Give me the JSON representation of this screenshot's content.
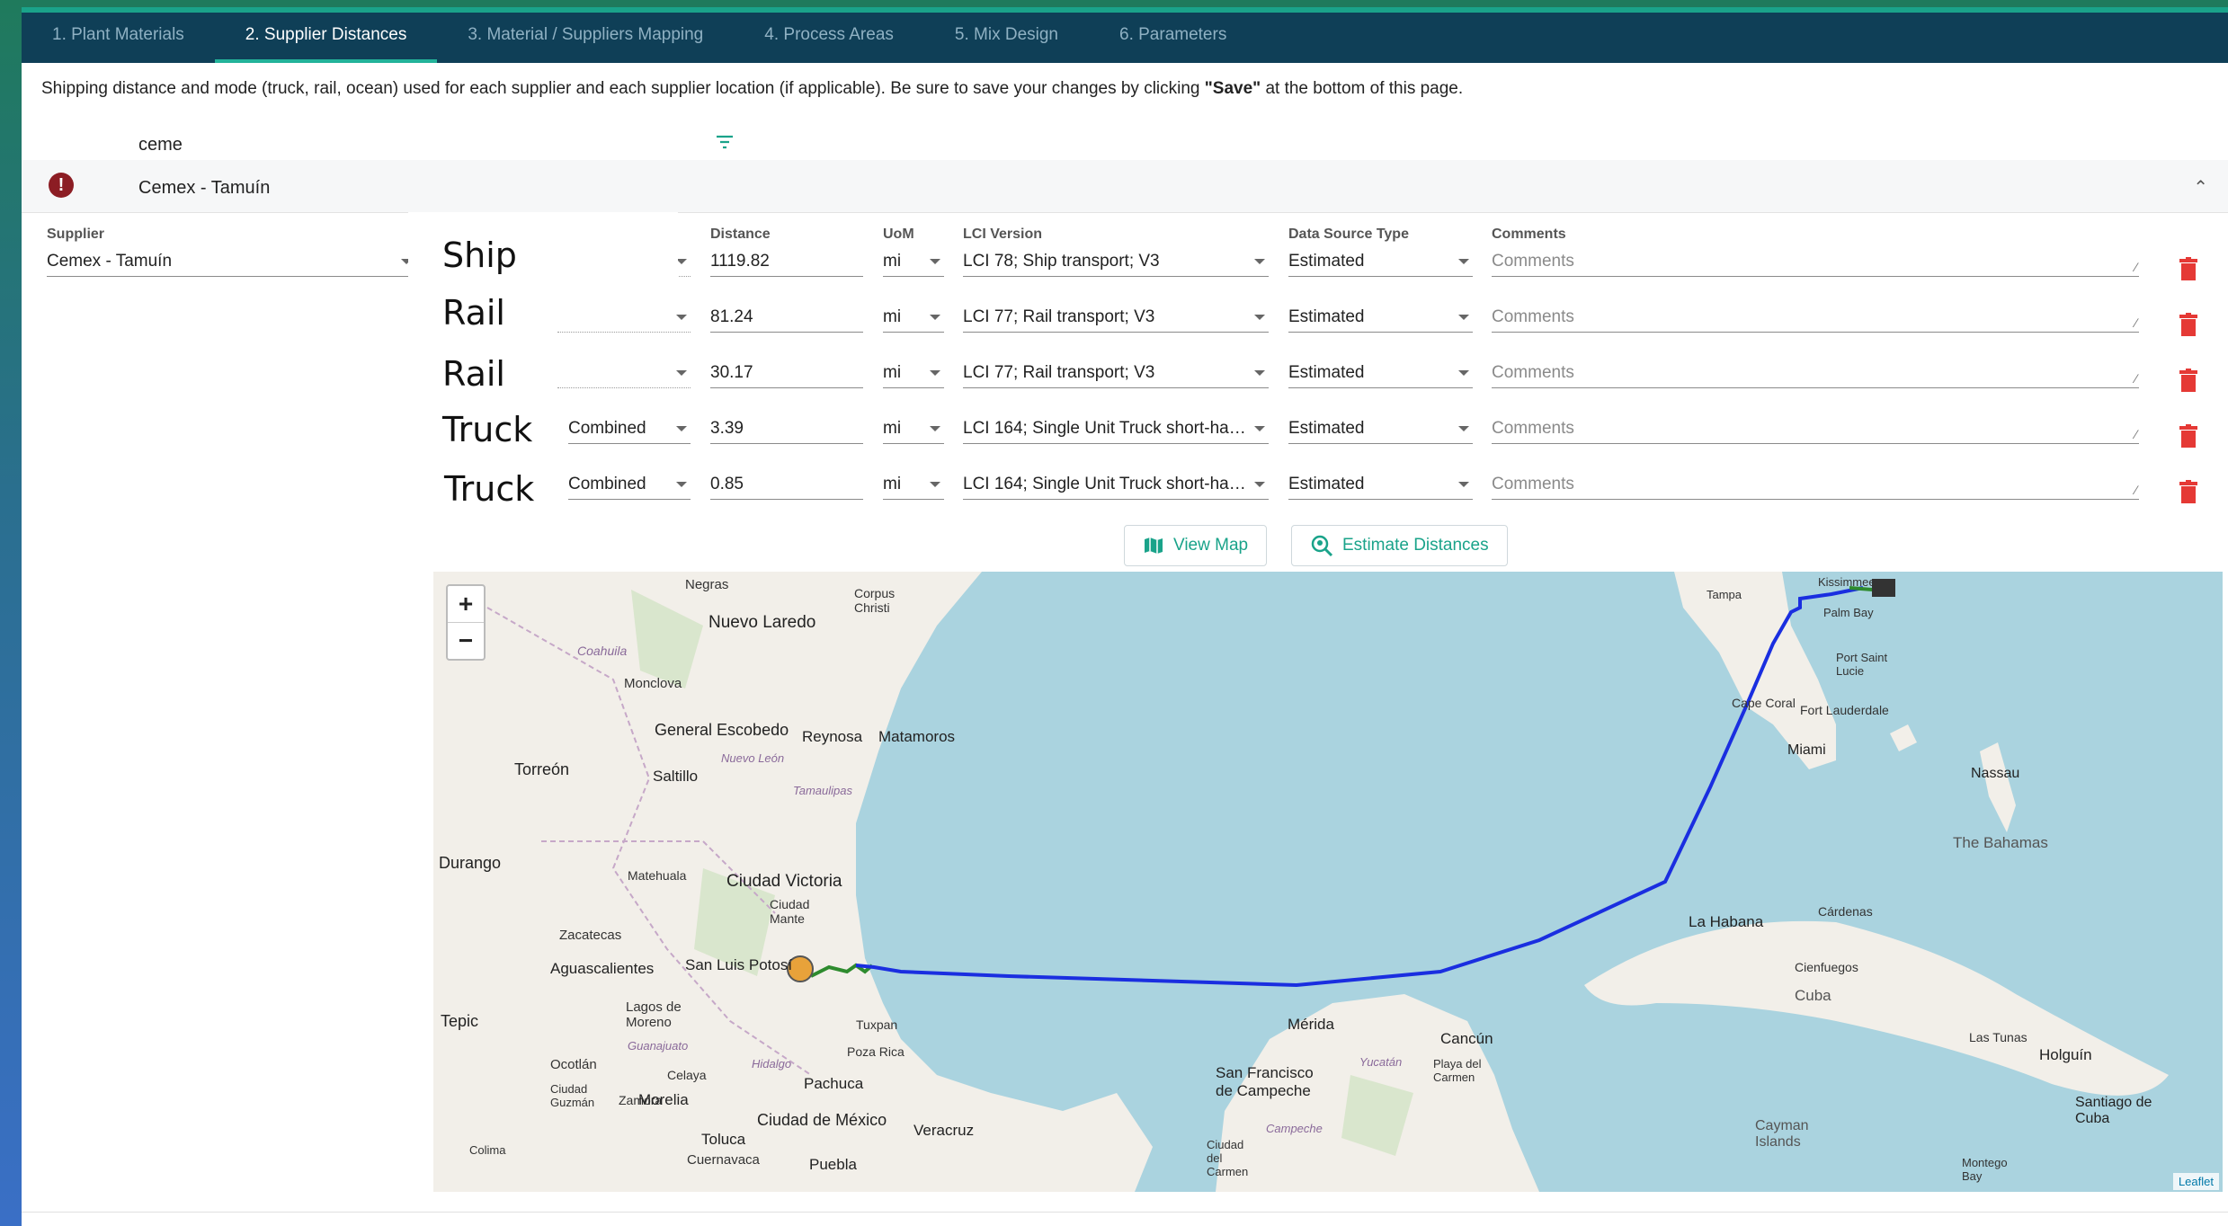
{
  "tabs": [
    {
      "label": "1. Plant Materials",
      "active": false
    },
    {
      "label": "2. Supplier Distances",
      "active": true
    },
    {
      "label": "3. Material / Suppliers Mapping",
      "active": false
    },
    {
      "label": "4. Process Areas",
      "active": false
    },
    {
      "label": "5. Mix Design",
      "active": false
    },
    {
      "label": "6. Parameters",
      "active": false
    }
  ],
  "info": {
    "text_before": "Shipping distance and mode (truck, rail, ocean) used for each supplier and each supplier location (if applicable). Be sure to save your changes by clicking ",
    "bold": "\"Save\"",
    "text_after": " at the bottom of this page."
  },
  "filter": {
    "value": "ceme",
    "icon": "filter-icon"
  },
  "panel": {
    "title": "Cemex - Tamuín",
    "status_icon": "error-icon",
    "collapse_icon": "chevron-up-icon"
  },
  "columns": {
    "supplier": "Supplier",
    "distance": "Distance",
    "uom": "UoM",
    "lci": "LCI Version",
    "source": "Data Source Type",
    "comments": "Comments"
  },
  "supplier_value": "Cemex - Tamuín",
  "rows": [
    {
      "mode_label": "Ship",
      "method": "",
      "distance": "1119.82",
      "uom": "mi",
      "lci": "LCI 78; Ship transport; V3",
      "source": "Estimated",
      "comments_placeholder": "Comments"
    },
    {
      "mode_label": "Rail",
      "method": "",
      "distance": "81.24",
      "uom": "mi",
      "lci": "LCI 77; Rail transport; V3",
      "source": "Estimated",
      "comments_placeholder": "Comments"
    },
    {
      "mode_label": "Rail",
      "method": "",
      "distance": "30.17",
      "uom": "mi",
      "lci": "LCI 77; Rail transport; V3",
      "source": "Estimated",
      "comments_placeholder": "Comments"
    },
    {
      "mode_label": "Truck",
      "method": "Combined",
      "distance": "3.39",
      "uom": "mi",
      "lci": "LCI 164; Single Unit Truck short-haul;...",
      "source": "Estimated",
      "comments_placeholder": "Comments"
    },
    {
      "mode_label": "Truck",
      "method": "Combined",
      "distance": "0.85",
      "uom": "mi",
      "lci": "LCI 164; Single Unit Truck short-haul;...",
      "source": "Estimated",
      "comments_placeholder": "Comments"
    }
  ],
  "buttons": {
    "view_map": "View Map",
    "estimate": "Estimate Distances"
  },
  "map": {
    "zoom_in": "+",
    "zoom_out": "−",
    "attribution": "Leaflet",
    "places": [
      {
        "name": "Negras"
      },
      {
        "name": "Corpus Christi"
      },
      {
        "name": "Nuevo Laredo"
      },
      {
        "name": "Coahuila"
      },
      {
        "name": "Monclova"
      },
      {
        "name": "General Escobedo"
      },
      {
        "name": "Reynosa"
      },
      {
        "name": "Matamoros"
      },
      {
        "name": "Nuevo León"
      },
      {
        "name": "Torreón"
      },
      {
        "name": "Saltillo"
      },
      {
        "name": "Tamaulipas"
      },
      {
        "name": "Durango"
      },
      {
        "name": "Matehuala"
      },
      {
        "name": "Ciudad Victoria"
      },
      {
        "name": "Ciudad Mante"
      },
      {
        "name": "Zacatecas"
      },
      {
        "name": "San Luis Potosí"
      },
      {
        "name": "Aguascalientes"
      },
      {
        "name": "Tepic"
      },
      {
        "name": "Lagos de Moreno"
      },
      {
        "name": "Guanajuato"
      },
      {
        "name": "Tuxpan"
      },
      {
        "name": "Poza Rica"
      },
      {
        "name": "Celaya"
      },
      {
        "name": "Hidalgo"
      },
      {
        "name": "Ocotlán"
      },
      {
        "name": "Ciudad Guzmán"
      },
      {
        "name": "Zamora"
      },
      {
        "name": "Morelia"
      },
      {
        "name": "Pachuca"
      },
      {
        "name": "Ciudad de México"
      },
      {
        "name": "Veracruz"
      },
      {
        "name": "Toluca"
      },
      {
        "name": "Cuernavaca"
      },
      {
        "name": "Puebla"
      },
      {
        "name": "Colima"
      },
      {
        "name": "Mérida"
      },
      {
        "name": "Cancún"
      },
      {
        "name": "San Francisco de Campeche"
      },
      {
        "name": "Yucatán"
      },
      {
        "name": "Playa del Carmen"
      },
      {
        "name": "Ciudad del Carmen"
      },
      {
        "name": "Campeche"
      },
      {
        "name": "Kissimmee"
      },
      {
        "name": "Tampa"
      },
      {
        "name": "Palm Bay"
      },
      {
        "name": "Port Saint Lucie"
      },
      {
        "name": "Cape Coral"
      },
      {
        "name": "Fort Lauderdale"
      },
      {
        "name": "Miami"
      },
      {
        "name": "Nassau"
      },
      {
        "name": "The Bahamas"
      },
      {
        "name": "La Habana"
      },
      {
        "name": "Cárdenas"
      },
      {
        "name": "Cienfuegos"
      },
      {
        "name": "Cuba"
      },
      {
        "name": "Las Tunas"
      },
      {
        "name": "Holguín"
      },
      {
        "name": "Santiago de Cuba"
      },
      {
        "name": "Cayman Islands"
      },
      {
        "name": "Montego Bay"
      }
    ]
  }
}
